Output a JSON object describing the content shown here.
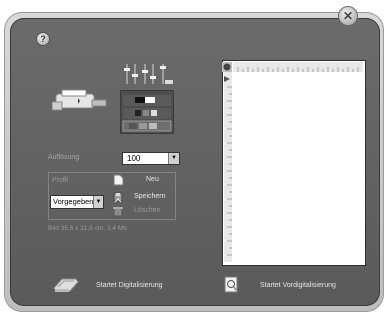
{
  "window": {
    "close_glyph": "✕",
    "help_glyph": "?"
  },
  "resolution": {
    "label": "Auflösung",
    "value": "100"
  },
  "profile": {
    "label": "Profil",
    "value": "Vorgegeben",
    "new_label": "Neu",
    "save_label": "Speichern",
    "delete_label": "Löschen"
  },
  "image_info": "Bild 35,6 x 21,6 cm, 3,4 Mb",
  "actions": {
    "scan_label": "Startet Digitalisierung",
    "preview_label": "Startet Vordigitalisierung"
  },
  "icons": {
    "close": "close-icon",
    "help": "help-icon",
    "scanner": "scanner-icon",
    "sliders": "adjustment-sliders-icon",
    "new": "new-document-icon",
    "save": "save-icon",
    "delete": "trash-icon",
    "scan": "scanner-hand-icon",
    "preview": "preview-magnifier-icon"
  },
  "colors": {
    "panel": "#5f5f5f",
    "frame": "#c8c8c8",
    "text": "#e6e6e6",
    "disabled_text": "#9a9a9a"
  }
}
